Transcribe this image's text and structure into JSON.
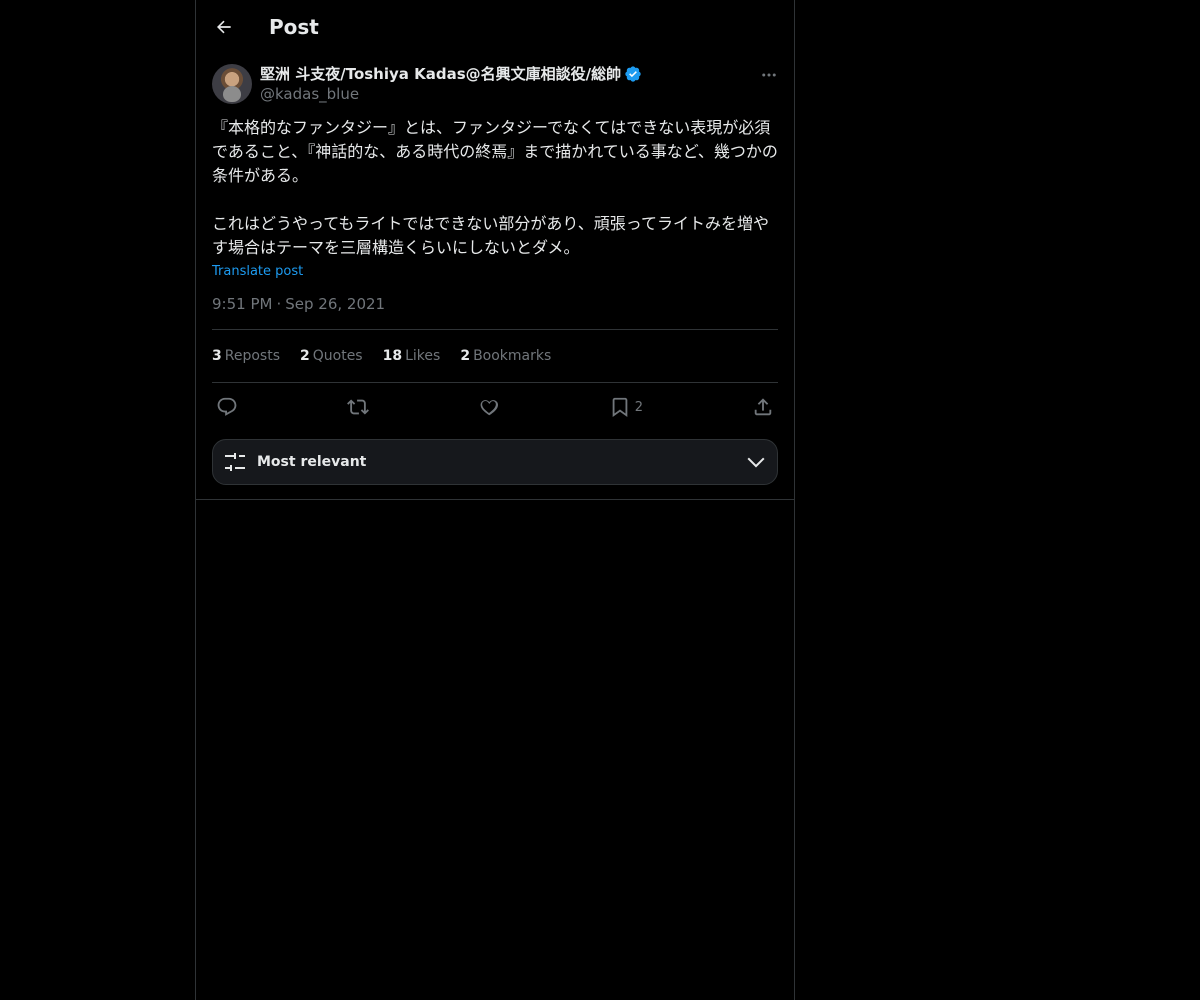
{
  "header": {
    "title": "Post"
  },
  "author": {
    "display_name": "堅洲 斗支夜/Toshiya Kadas@名興文庫相談役/総帥",
    "handle": "@kadas_blue",
    "verified": true
  },
  "post": {
    "paragraphs": [
      "『本格的なファンタジー』とは、ファンタジーでなくてはできない表現が必須であること、『神話的な、ある時代の終焉』まで描かれている事など、幾つかの条件がある。",
      "これはどうやってもライトではできない部分があり、頑張ってライトみを増やす場合はテーマを三層構造くらいにしないとダメ。"
    ],
    "translate_label": "Translate post",
    "time": "9:51 PM",
    "separator": "·",
    "date": "Sep 26, 2021"
  },
  "stats": {
    "reposts_count": "3",
    "reposts_label": "Reposts",
    "quotes_count": "2",
    "quotes_label": "Quotes",
    "likes_count": "18",
    "likes_label": "Likes",
    "bookmarks_count": "2",
    "bookmarks_label": "Bookmarks"
  },
  "actions": {
    "bookmark_count": "2"
  },
  "sort": {
    "label": "Most relevant"
  },
  "icons": {
    "back": "arrow-left-icon",
    "more": "more-horizontal-icon",
    "reply": "reply-icon",
    "repost": "repost-icon",
    "like": "heart-icon",
    "bookmark": "bookmark-icon",
    "share": "share-icon",
    "sort": "sliders-icon",
    "chevron": "chevron-down-icon"
  },
  "colors": {
    "background": "#000000",
    "text": "#e7e9ea",
    "muted": "#71767b",
    "accent": "#1d9bf0",
    "border": "#2f3336"
  }
}
